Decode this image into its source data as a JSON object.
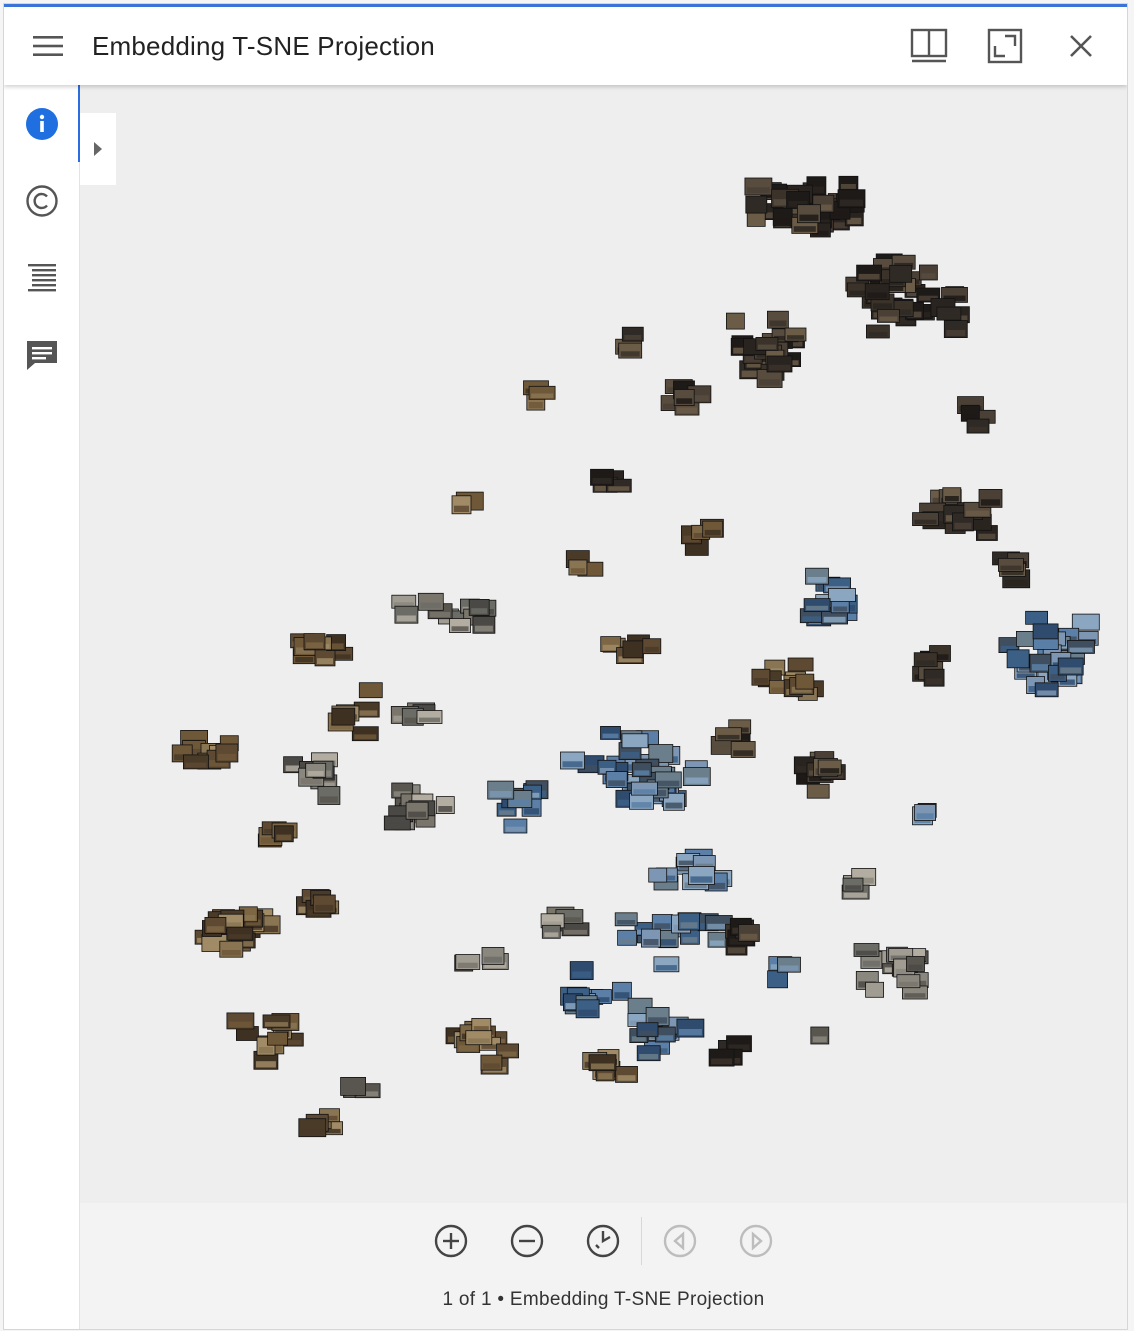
{
  "window": {
    "title": "Embedding T-SNE Projection",
    "accent_color": "#3b73d9"
  },
  "titlebar": {
    "menu_icon": "hamburger-menu-icon",
    "actions": [
      {
        "name": "two-page-view",
        "icon": "book-open-icon"
      },
      {
        "name": "fullscreen",
        "icon": "fullscreen-icon"
      },
      {
        "name": "close",
        "icon": "close-icon"
      }
    ]
  },
  "sidebar": {
    "items": [
      {
        "name": "information",
        "icon": "info-icon",
        "active": true
      },
      {
        "name": "rights",
        "icon": "copyright-icon",
        "active": false
      },
      {
        "name": "structure",
        "icon": "index-list-icon",
        "active": false
      },
      {
        "name": "annotations",
        "icon": "comment-icon",
        "active": false
      }
    ]
  },
  "viewer": {
    "drawer_icon": "chevron-right-icon",
    "background": "#eeeeee"
  },
  "footer": {
    "controls": [
      {
        "name": "zoom-in",
        "icon": "zoom-in-icon",
        "enabled": true
      },
      {
        "name": "zoom-out",
        "icon": "zoom-out-icon",
        "enabled": true
      },
      {
        "name": "reset-zoom",
        "icon": "reset-zoom-icon",
        "enabled": true
      },
      {
        "name": "previous-page",
        "icon": "previous-icon",
        "enabled": false
      },
      {
        "name": "next-page",
        "icon": "next-icon",
        "enabled": false
      }
    ],
    "page_label": "1 of 1 • Embedding T-SNE Projection"
  }
}
